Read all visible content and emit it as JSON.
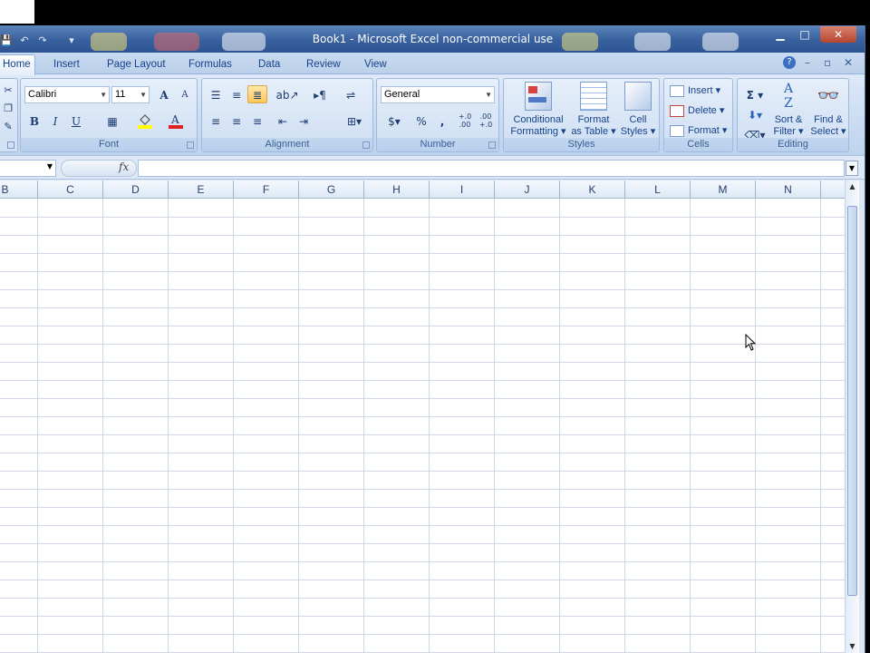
{
  "window": {
    "title": "Book1 - Microsoft Excel non-commercial use",
    "controls": {
      "minimize": "▁",
      "maximize": "□",
      "close": "✕"
    }
  },
  "qat": {
    "save": "💾",
    "undo": "↶",
    "redo": "↷",
    "customize": "▾"
  },
  "tabs": [
    "Home",
    "Insert",
    "Page Layout",
    "Formulas",
    "Data",
    "Review",
    "View"
  ],
  "tab_right": {
    "help": "?",
    "minimize": "–",
    "restore": "▫",
    "close": "✕"
  },
  "ribbon": {
    "font": {
      "label": "Font",
      "font_name": "Calibri",
      "font_size": "11",
      "grow": "A",
      "shrink": "A",
      "bold": "B",
      "italic": "I",
      "underline": "U",
      "fill_color": "#ffff00",
      "font_color": "#e02020"
    },
    "alignment": {
      "label": "Alignment"
    },
    "number": {
      "label": "Number",
      "format": "General",
      "percent": "%",
      "comma": ",",
      "inc_dec": "+.0 .00",
      "dec_dec": ".00 +.0"
    },
    "styles": {
      "label": "Styles",
      "conditional_1": "Conditional",
      "conditional_2": "Formatting ▾",
      "table_1": "Format",
      "table_2": "as Table ▾",
      "cell_1": "Cell",
      "cell_2": "Styles ▾"
    },
    "cells": {
      "label": "Cells",
      "insert": "Insert ▾",
      "delete": "Delete ▾",
      "format": "Format ▾"
    },
    "editing": {
      "label": "Editing",
      "sigma": "Σ ▾",
      "fill": "▾",
      "clear": "▾",
      "sort_1": "Sort &",
      "sort_2": "Filter ▾",
      "find_1": "Find &",
      "find_2": "Select ▾"
    }
  },
  "formula_bar": {
    "name_box": "",
    "fx": "fx",
    "formula": ""
  },
  "columns": [
    "B",
    "C",
    "D",
    "E",
    "F",
    "G",
    "H",
    "I",
    "J",
    "K",
    "L",
    "M",
    "N"
  ],
  "colors": {
    "title_bar": "#3a62a0",
    "accent": "#15428b",
    "grid_line": "#d0d7e5"
  }
}
